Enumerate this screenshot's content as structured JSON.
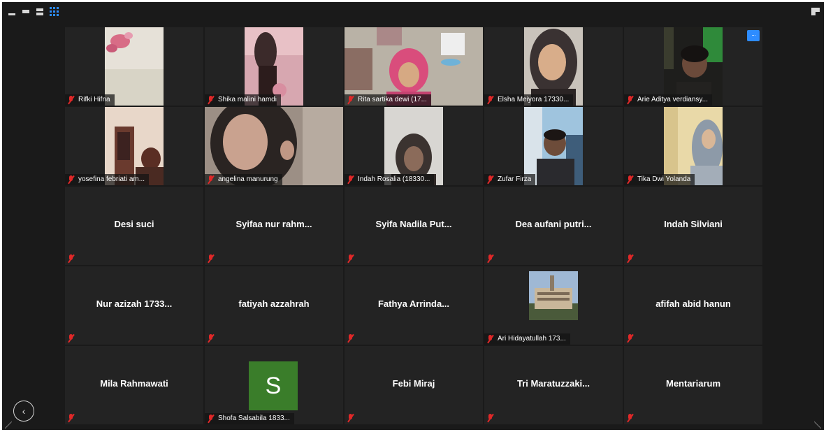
{
  "participants": [
    {
      "name": "Rifki Hifna",
      "has_video": true
    },
    {
      "name": "Shika malini hamdi",
      "has_video": true
    },
    {
      "name": "Rita sartika dewi (17...",
      "has_video": true
    },
    {
      "name": "Elsha Meiyora 17330...",
      "has_video": true
    },
    {
      "name": "Arie Aditya verdiansy...",
      "has_video": true
    },
    {
      "name": "yosefina febriati am...",
      "has_video": true
    },
    {
      "name": "angelina manurung",
      "has_video": true
    },
    {
      "name": "Indah Rosalia (18330...",
      "has_video": true
    },
    {
      "name": "Zufar Firza",
      "has_video": true
    },
    {
      "name": "Tika Dwi Yolanda",
      "has_video": true
    },
    {
      "name": "Desi suci",
      "has_video": false
    },
    {
      "name": "Syifaa nur rahm...",
      "has_video": false
    },
    {
      "name": "Syifa Nadila Put...",
      "has_video": false
    },
    {
      "name": "Dea aufani putri...",
      "has_video": false
    },
    {
      "name": "Indah Silviani",
      "has_video": false
    },
    {
      "name": "Nur azizah 1733...",
      "has_video": false
    },
    {
      "name": "fatiyah azzahrah",
      "has_video": false
    },
    {
      "name": "Fathya Arrinda...",
      "has_video": false
    },
    {
      "name": "Ari Hidayatullah 173...",
      "has_video": false,
      "has_picture": true
    },
    {
      "name": "afifah abid hanun",
      "has_video": false
    },
    {
      "name": "Mila Rahmawati",
      "has_video": false
    },
    {
      "name": "Shofa Salsabila 1833...",
      "has_video": false,
      "avatar_letter": "S",
      "avatar_color": "#3a7d2a"
    },
    {
      "name": "Febi Miraj",
      "has_video": false
    },
    {
      "name": "Tri  Maratuzzaki...",
      "has_video": false
    },
    {
      "name": "Mentariarum",
      "has_video": false
    }
  ],
  "controls": {
    "more_label": "···",
    "back_label": "‹"
  },
  "colors": {
    "background": "#1a1a1a",
    "tile": "#232323",
    "accent": "#2d8cff",
    "muted_mic": "#e02828"
  },
  "icons": [
    "minimize-icon",
    "thumbnail-view-icon",
    "speaker-view-icon",
    "gallery-view-icon",
    "exit-fullscreen-icon",
    "muted-mic-icon",
    "chevron-left-icon"
  ]
}
